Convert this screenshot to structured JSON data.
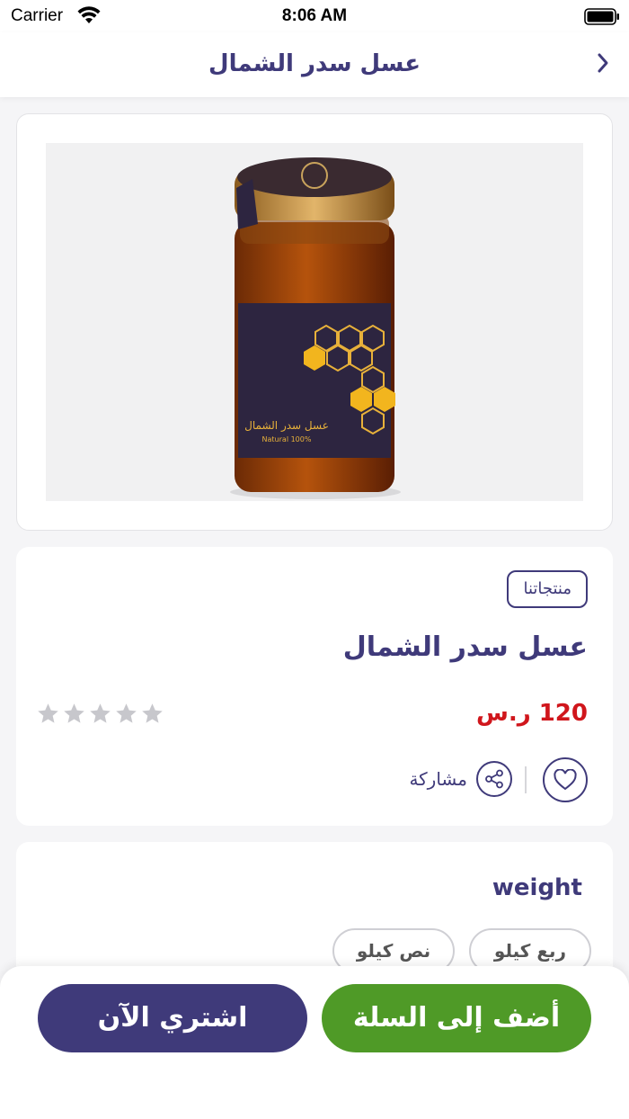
{
  "status_bar": {
    "carrier": "Carrier",
    "time": "8:06 AM"
  },
  "nav": {
    "title": "عسل سدر الشمال",
    "back_icon": "chevron-right-icon"
  },
  "product": {
    "category": "منتجاتنا",
    "name": "عسل سدر الشمال",
    "price": "120 ر.س",
    "rating": 0,
    "rating_max": 5,
    "share_label": "مشاركة",
    "image_label": "عسل سدر الشمال",
    "image_sublabel": "Natural 100%"
  },
  "weight": {
    "title": "weight",
    "options": [
      "ربع كيلو",
      "نص كيلو"
    ]
  },
  "actions": {
    "add_to_cart": "أضف إلى السلة",
    "buy_now": "اشتري الآن"
  },
  "colors": {
    "primary": "#3f3a7a",
    "accent_green": "#4f9a27",
    "price_red": "#d0161c",
    "star_gray": "#c7c7cc"
  }
}
